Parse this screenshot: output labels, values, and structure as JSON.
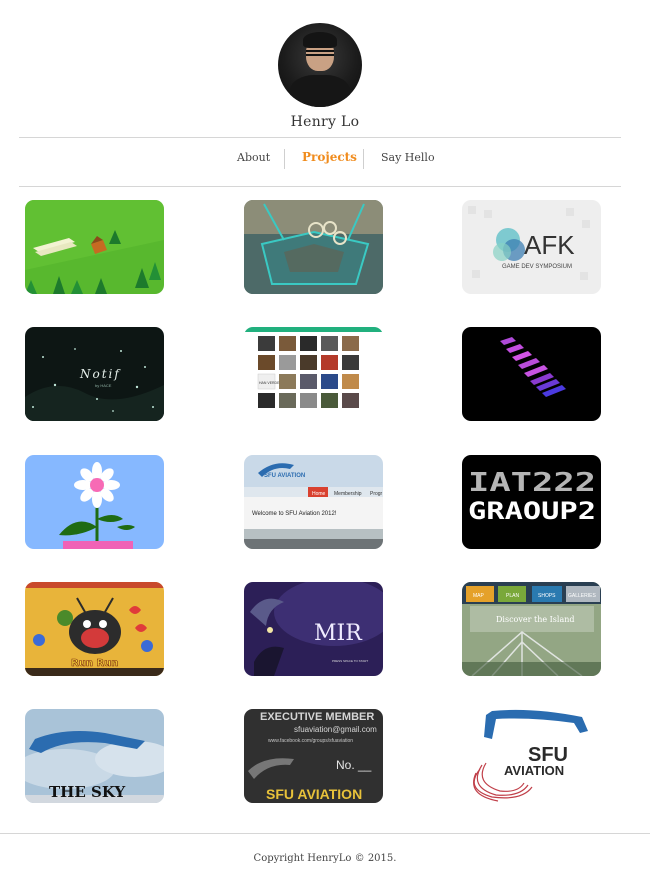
{
  "profile": {
    "name": "Henry Lo"
  },
  "nav": {
    "items": [
      {
        "label": "About"
      },
      {
        "label": "Projects"
      },
      {
        "label": "Say Hello"
      }
    ],
    "active": "Projects"
  },
  "projects": [
    {
      "icon": "green-island-thumbnail"
    },
    {
      "icon": "3d-room-thumbnail"
    },
    {
      "icon": "afk-logo-thumbnail",
      "title": "AFK",
      "subtitle": "GAME DEV SYMPOSIUM"
    },
    {
      "icon": "notif-thumbnail",
      "title": "Notif",
      "subtitle": "by HACE"
    },
    {
      "icon": "photo-grid-thumbnail",
      "caption": "HAN VERDE"
    },
    {
      "icon": "purple-bars-thumbnail"
    },
    {
      "icon": "flower-pot-thumbnail"
    },
    {
      "icon": "sfu-aviation-website-thumbnail",
      "logo": "SFU AVIATION",
      "tabs": [
        "Home",
        "Membership",
        "Progr"
      ],
      "headline": "Welcome to SFU Aviation 2012!"
    },
    {
      "icon": "iat222-thumbnail",
      "line1": "IAT222",
      "line2": "GRAOUP2"
    },
    {
      "icon": "run-run-thumbnail",
      "title": "Run Run"
    },
    {
      "icon": "mir-thumbnail",
      "title": "MIR",
      "footer": "PRESS SPACE TO START"
    },
    {
      "icon": "discover-island-thumbnail",
      "tabs": [
        "MAP",
        "PLAN",
        "SHOPS",
        "GALLERIES"
      ],
      "headline": "Discover the Island"
    },
    {
      "icon": "the-sky-thumbnail",
      "title": "THE SKY"
    },
    {
      "icon": "executive-member-card-thumbnail",
      "title": "EXECUTIVE MEMBER",
      "email": "sfuaviation@gmail.com",
      "url": "www.facebook.com/groups/sfuaviation",
      "number": "No. __",
      "brand": "SFU AVIATION"
    },
    {
      "icon": "sfu-aviation-logo-thumbnail",
      "line1": "SFU",
      "line2": "AVIATION"
    }
  ],
  "footer": {
    "copyright": "Copyright HenryLo © 2015."
  }
}
